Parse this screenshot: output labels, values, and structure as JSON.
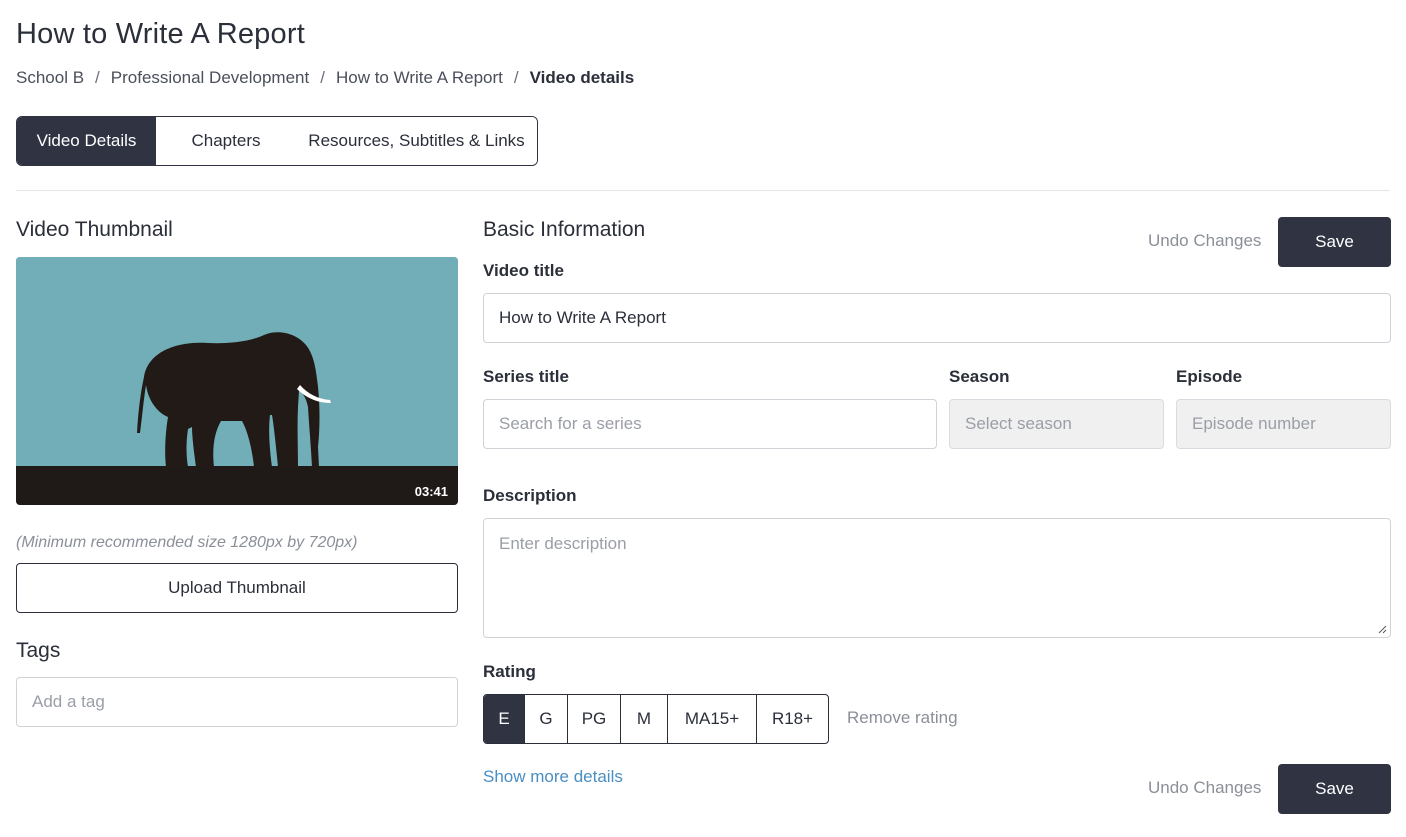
{
  "page": {
    "title": "How to Write A Report"
  },
  "breadcrumb": {
    "items": [
      "School B",
      "Professional Development",
      "How to Write A Report"
    ],
    "separator": "/",
    "current": "Video details"
  },
  "tabs": [
    {
      "label": "Video Details",
      "active": true
    },
    {
      "label": "Chapters",
      "active": false
    },
    {
      "label": "Resources, Subtitles & Links",
      "active": false
    }
  ],
  "thumbnail": {
    "heading": "Video Thumbnail",
    "duration": "03:41",
    "hint": "(Minimum recommended size 1280px by 720px)",
    "upload_label": "Upload Thumbnail",
    "colors": {
      "sky": "#72aeb7",
      "ground": "#1f1a17",
      "elephant": "#221a17",
      "tusk": "#ffffff"
    }
  },
  "tags": {
    "heading": "Tags",
    "placeholder": "Add a tag"
  },
  "basic": {
    "heading": "Basic Information",
    "undo_label": "Undo Changes",
    "save_label": "Save",
    "video_title_label": "Video title",
    "video_title_value": "How to Write A Report",
    "series_label": "Series title",
    "series_placeholder": "Search for a series",
    "season_label": "Season",
    "season_placeholder": "Select season",
    "episode_label": "Episode",
    "episode_placeholder": "Episode number",
    "description_label": "Description",
    "description_placeholder": "Enter description",
    "rating_label": "Rating",
    "ratings": [
      {
        "label": "E",
        "active": true
      },
      {
        "label": "G",
        "active": false
      },
      {
        "label": "PG",
        "active": false
      },
      {
        "label": "M",
        "active": false
      },
      {
        "label": "MA15+",
        "active": false
      },
      {
        "label": "R18+",
        "active": false
      }
    ],
    "remove_rating_label": "Remove rating",
    "show_more_label": "Show more details"
  },
  "colors": {
    "primary": "#2f3342",
    "link": "#4a8ec2",
    "muted": "#8a8f98",
    "border": "#cfd3d8",
    "disabled_bg": "#f0f0f0"
  }
}
